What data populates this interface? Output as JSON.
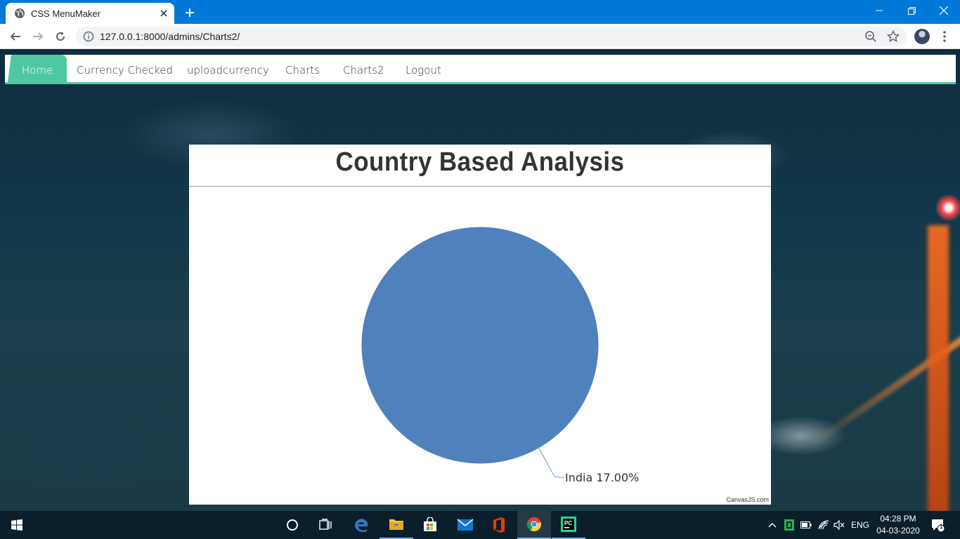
{
  "browser": {
    "tab_title": "CSS MenuMaker",
    "url": "127.0.0.1:8000/admins/Charts2/"
  },
  "nav": {
    "items": [
      {
        "label": "Home",
        "active": true
      },
      {
        "label": "Currency Checked"
      },
      {
        "label": "uploadcurrency"
      },
      {
        "label": "Charts"
      },
      {
        "label": "Charts2"
      },
      {
        "label": "Logout"
      }
    ],
    "accent": "#4fc7a4"
  },
  "chart_data": {
    "type": "pie",
    "title": "Country Based Analysis",
    "slices": [
      {
        "label": "India",
        "value": 17.0,
        "display": "India 17.00%",
        "color": "#4f81bc"
      }
    ],
    "credit": "CanvasJS.com"
  },
  "taskbar": {
    "icons": [
      "start-icon",
      "cortana-icon",
      "task-view-icon",
      "edge-icon",
      "file-explorer-icon",
      "store-icon",
      "mail-icon",
      "office-icon",
      "chrome-icon",
      "pycharm-icon"
    ],
    "lang": "ENG",
    "time": "04:28 PM",
    "date": "04-03-2020",
    "notification_count": "1"
  }
}
